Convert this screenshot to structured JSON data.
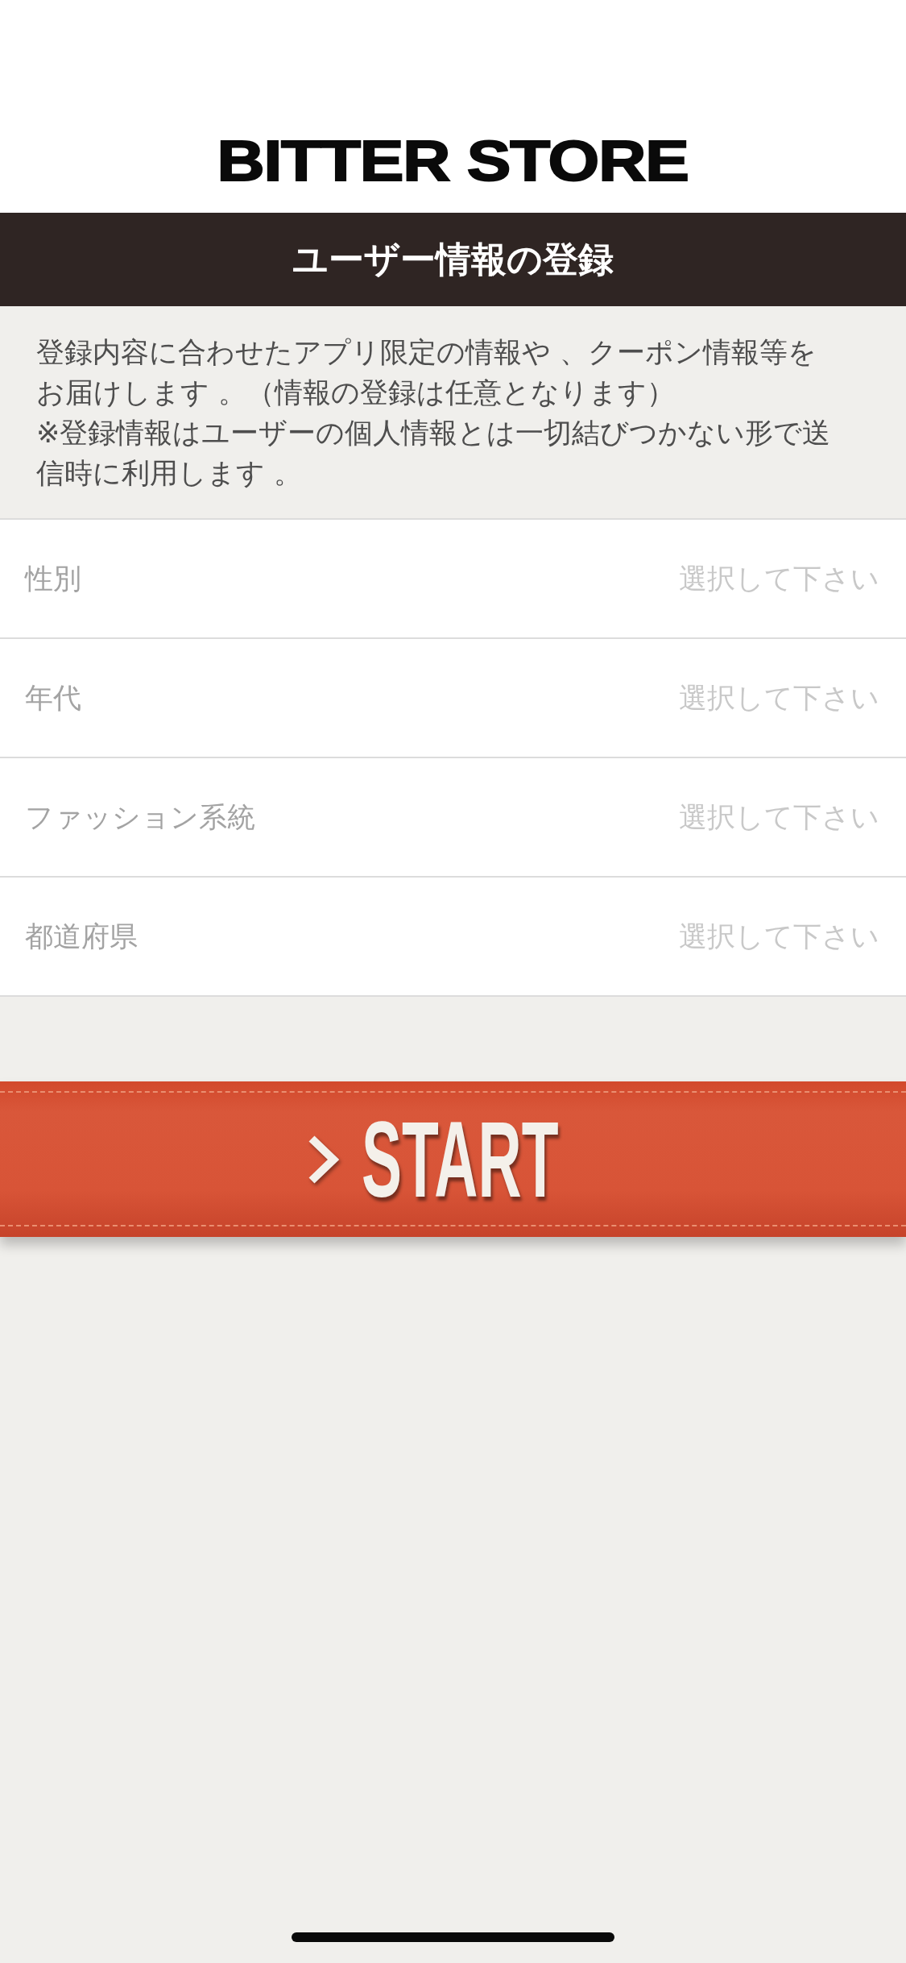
{
  "logo": {
    "text": "BITTER STORE"
  },
  "title_bar": {
    "title": "ユーザー情報の登録"
  },
  "intro": {
    "paragraphs": [
      "登録内容に合わせたアプリ限定の情報や 、クーポン情報等をお届けします 。（情報の登録は任意となります）",
      "※登録情報はユーザーの個人情報とは一切結びつかない形で送信時に利用します 。"
    ]
  },
  "fields": [
    {
      "label": "性別",
      "placeholder": "選択して下さい"
    },
    {
      "label": "年代",
      "placeholder": "選択して下さい"
    },
    {
      "label": "ファッション系統",
      "placeholder": "選択して下さい"
    },
    {
      "label": "都道府県",
      "placeholder": "選択して下さい"
    }
  ],
  "start_button": {
    "label": "START"
  }
}
